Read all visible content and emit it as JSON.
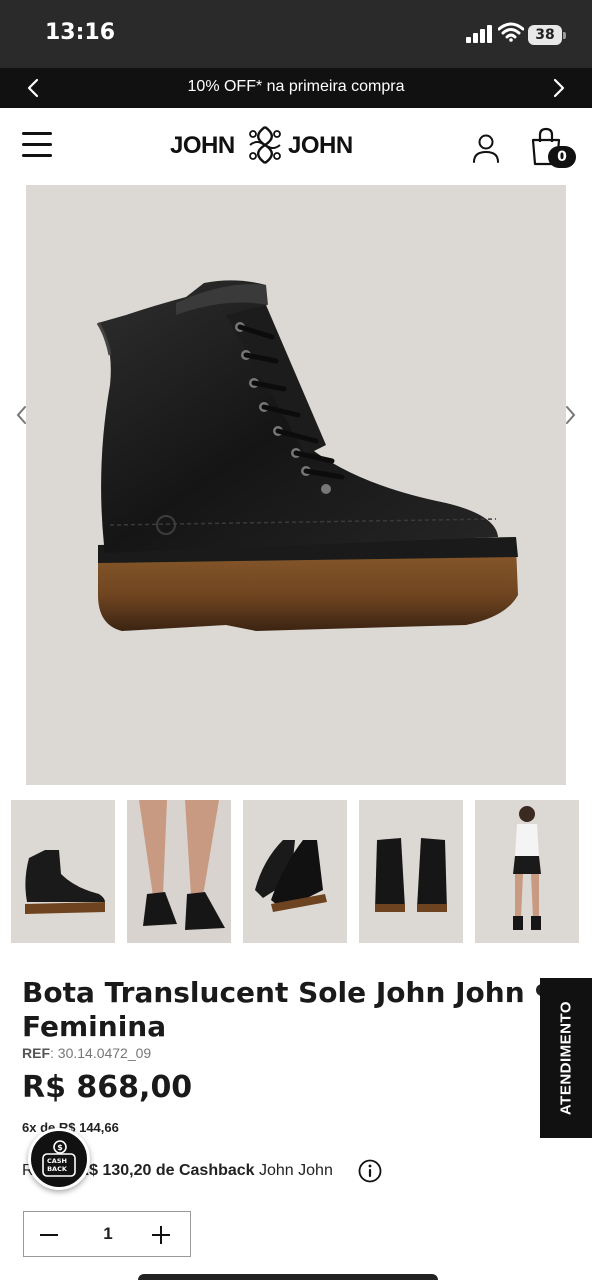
{
  "status_bar": {
    "time": "13:16",
    "battery": "38"
  },
  "promo": {
    "text": "10% OFF* na primeira compra"
  },
  "header": {
    "logo_left": "JOHN",
    "logo_right": "JOHN",
    "cart_count": "0"
  },
  "product": {
    "title": "Bota Translucent Sole John John Feminina",
    "ref_label": "REF",
    "ref_value": ": 30.14.0472_09",
    "price": "R$ 868,00",
    "installment": "6x de R$ 144,66",
    "cashback_prefix": "R",
    "cashback_amount": "R$ 130,20 de Cashback",
    "cashback_suffix": " John John",
    "quantity": "1"
  },
  "support": {
    "label": "ATENDIMENTO"
  },
  "cashback_fab": {
    "line1": "CASH",
    "line2": "BACK"
  },
  "thumbnails": [
    "boot-side",
    "legs-wearing-boots",
    "boot-pair-angle",
    "boot-pair-back",
    "model-full-body"
  ],
  "colors": {
    "status_bg": "#2a2a2a",
    "promo_bg": "#111111",
    "image_bg": "#dcd8d4",
    "text_primary": "#1a1a1a",
    "accent_dark": "#111111"
  }
}
